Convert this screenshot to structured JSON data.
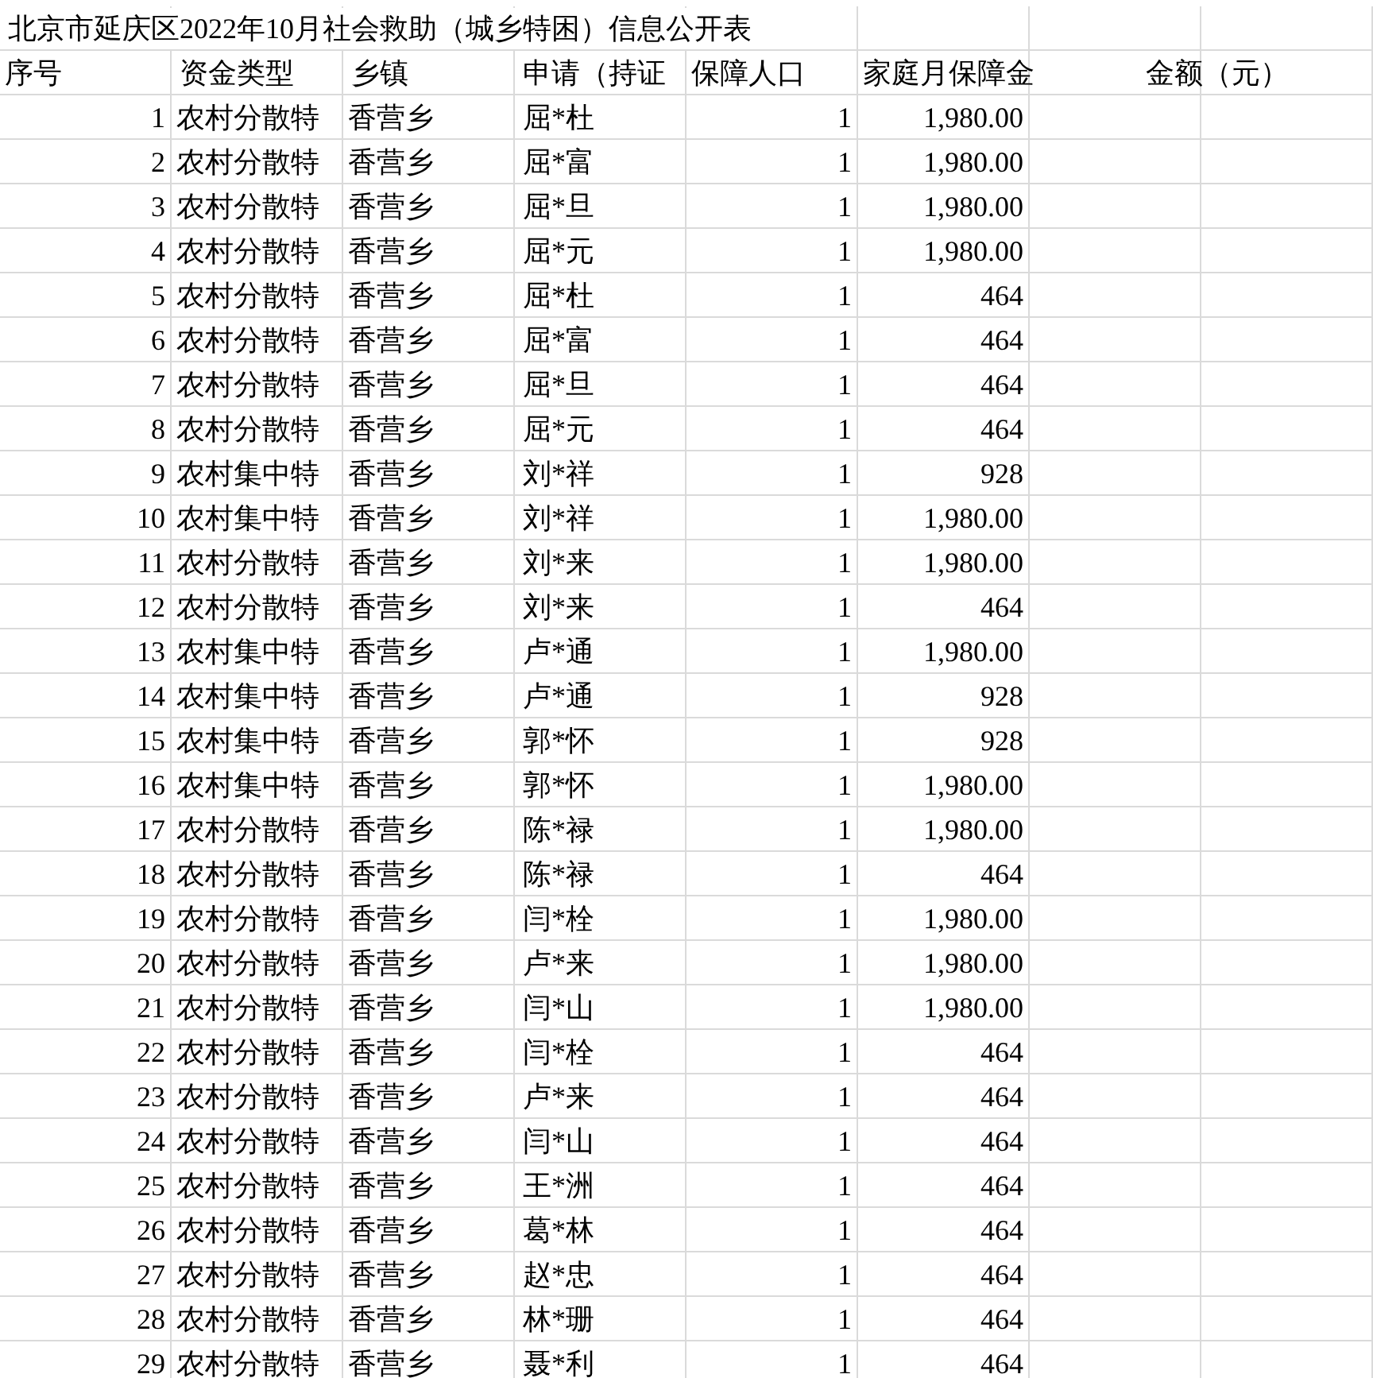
{
  "title": "北京市延庆区2022年10月社会救助（城乡特困）信息公开表",
  "columns": [
    "序号",
    "资金类型",
    "乡镇",
    "申请（持证",
    "保障人口",
    "家庭月保障金",
    "金额（元）"
  ],
  "rows": [
    {
      "no": "1",
      "fund_type": "农村分散特",
      "town": "香营乡",
      "applicant": "屈*杜",
      "persons": "1",
      "amount": "1,980.00"
    },
    {
      "no": "2",
      "fund_type": "农村分散特",
      "town": "香营乡",
      "applicant": "屈*富",
      "persons": "1",
      "amount": "1,980.00"
    },
    {
      "no": "3",
      "fund_type": "农村分散特",
      "town": "香营乡",
      "applicant": "屈*旦",
      "persons": "1",
      "amount": "1,980.00"
    },
    {
      "no": "4",
      "fund_type": "农村分散特",
      "town": "香营乡",
      "applicant": "屈*元",
      "persons": "1",
      "amount": "1,980.00"
    },
    {
      "no": "5",
      "fund_type": "农村分散特",
      "town": "香营乡",
      "applicant": "屈*杜",
      "persons": "1",
      "amount": "464"
    },
    {
      "no": "6",
      "fund_type": "农村分散特",
      "town": "香营乡",
      "applicant": "屈*富",
      "persons": "1",
      "amount": "464"
    },
    {
      "no": "7",
      "fund_type": "农村分散特",
      "town": "香营乡",
      "applicant": "屈*旦",
      "persons": "1",
      "amount": "464"
    },
    {
      "no": "8",
      "fund_type": "农村分散特",
      "town": "香营乡",
      "applicant": "屈*元",
      "persons": "1",
      "amount": "464"
    },
    {
      "no": "9",
      "fund_type": "农村集中特",
      "town": "香营乡",
      "applicant": "刘*祥",
      "persons": "1",
      "amount": "928"
    },
    {
      "no": "10",
      "fund_type": "农村集中特",
      "town": "香营乡",
      "applicant": "刘*祥",
      "persons": "1",
      "amount": "1,980.00"
    },
    {
      "no": "11",
      "fund_type": "农村分散特",
      "town": "香营乡",
      "applicant": "刘*来",
      "persons": "1",
      "amount": "1,980.00"
    },
    {
      "no": "12",
      "fund_type": "农村分散特",
      "town": "香营乡",
      "applicant": "刘*来",
      "persons": "1",
      "amount": "464"
    },
    {
      "no": "13",
      "fund_type": "农村集中特",
      "town": "香营乡",
      "applicant": "卢*通",
      "persons": "1",
      "amount": "1,980.00"
    },
    {
      "no": "14",
      "fund_type": "农村集中特",
      "town": "香营乡",
      "applicant": "卢*通",
      "persons": "1",
      "amount": "928"
    },
    {
      "no": "15",
      "fund_type": "农村集中特",
      "town": "香营乡",
      "applicant": "郭*怀",
      "persons": "1",
      "amount": "928"
    },
    {
      "no": "16",
      "fund_type": "农村集中特",
      "town": "香营乡",
      "applicant": "郭*怀",
      "persons": "1",
      "amount": "1,980.00"
    },
    {
      "no": "17",
      "fund_type": "农村分散特",
      "town": "香营乡",
      "applicant": "陈*禄",
      "persons": "1",
      "amount": "1,980.00"
    },
    {
      "no": "18",
      "fund_type": "农村分散特",
      "town": "香营乡",
      "applicant": "陈*禄",
      "persons": "1",
      "amount": "464"
    },
    {
      "no": "19",
      "fund_type": "农村分散特",
      "town": "香营乡",
      "applicant": "闫*栓",
      "persons": "1",
      "amount": "1,980.00"
    },
    {
      "no": "20",
      "fund_type": "农村分散特",
      "town": "香营乡",
      "applicant": "卢*来",
      "persons": "1",
      "amount": "1,980.00"
    },
    {
      "no": "21",
      "fund_type": "农村分散特",
      "town": "香营乡",
      "applicant": "闫*山",
      "persons": "1",
      "amount": "1,980.00"
    },
    {
      "no": "22",
      "fund_type": "农村分散特",
      "town": "香营乡",
      "applicant": "闫*栓",
      "persons": "1",
      "amount": "464"
    },
    {
      "no": "23",
      "fund_type": "农村分散特",
      "town": "香营乡",
      "applicant": "卢*来",
      "persons": "1",
      "amount": "464"
    },
    {
      "no": "24",
      "fund_type": "农村分散特",
      "town": "香营乡",
      "applicant": "闫*山",
      "persons": "1",
      "amount": "464"
    },
    {
      "no": "25",
      "fund_type": "农村分散特",
      "town": "香营乡",
      "applicant": "王*洲",
      "persons": "1",
      "amount": "464"
    },
    {
      "no": "26",
      "fund_type": "农村分散特",
      "town": "香营乡",
      "applicant": "葛*林",
      "persons": "1",
      "amount": "464"
    },
    {
      "no": "27",
      "fund_type": "农村分散特",
      "town": "香营乡",
      "applicant": "赵*忠",
      "persons": "1",
      "amount": "464"
    },
    {
      "no": "28",
      "fund_type": "农村分散特",
      "town": "香营乡",
      "applicant": "林*珊",
      "persons": "1",
      "amount": "464"
    },
    {
      "no": "29",
      "fund_type": "农村分散特",
      "town": "香营乡",
      "applicant": "聂*利",
      "persons": "1",
      "amount": "464"
    }
  ]
}
